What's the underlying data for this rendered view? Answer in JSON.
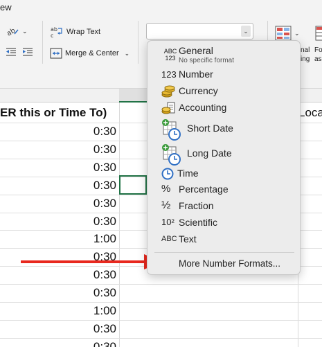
{
  "ribbon": {
    "tab_partial": "ew",
    "wrap_text": "Wrap Text",
    "merge_center": "Merge & Center",
    "number_format_value": "",
    "cut_right_1a": "nal",
    "cut_right_1b": "ing",
    "cut_right_2a": "Fo",
    "cut_right_2b": "as",
    "icons": [
      "orientation-icon",
      "decrease-indent-icon",
      "increase-indent-icon",
      "wrap-text-icon",
      "merge-center-icon",
      "conditional-formatting-icon"
    ]
  },
  "sheet": {
    "header_text": "ER this or Time To)",
    "next_header": "Loca",
    "times": [
      "0:30",
      "0:30",
      "0:30",
      "0:30",
      "0:30",
      "0:30",
      "1:00",
      "0:30",
      "0:30",
      "0:30",
      "1:00",
      "0:30",
      "0:30"
    ]
  },
  "number_format_menu": {
    "items": [
      {
        "label": "General",
        "sublabel": "No specific format",
        "icon": "abc-123-icon",
        "icon_text": "ABC 123"
      },
      {
        "label": "Number",
        "icon": "number-123-icon",
        "icon_text": "123"
      },
      {
        "label": "Currency",
        "icon": "coins-icon"
      },
      {
        "label": "Accounting",
        "icon": "accounting-icon"
      },
      {
        "label": "Short Date",
        "icon": "calendar-clock-icon"
      },
      {
        "label": "Long Date",
        "icon": "calendar-clock-icon"
      },
      {
        "label": "Time",
        "icon": "clock-icon"
      },
      {
        "label": "Percentage",
        "icon": "percent-icon",
        "icon_text": "%"
      },
      {
        "label": "Fraction",
        "icon": "fraction-icon",
        "icon_text": "½"
      },
      {
        "label": "Scientific",
        "icon": "scientific-icon",
        "icon_text": "10²"
      },
      {
        "label": "Text",
        "icon": "abc-icon",
        "icon_text": "ABC"
      }
    ],
    "more": "More Number Formats..."
  },
  "colors": {
    "arrow": "#e8281e",
    "selection": "#217346",
    "clock": "#2f6fc4",
    "calendar_badge": "#3a9b3a",
    "coin": "#d4a017"
  }
}
